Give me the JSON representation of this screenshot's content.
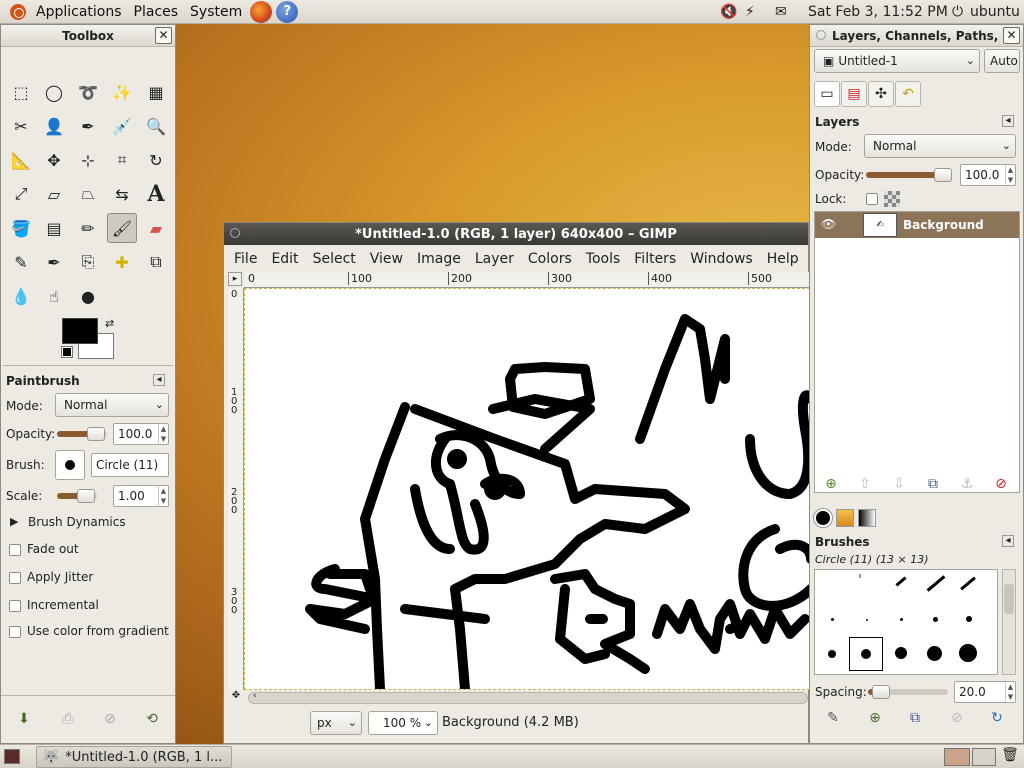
{
  "top_panel": {
    "menus": [
      "Applications",
      "Places",
      "System"
    ],
    "clock": "Sat Feb  3, 11:52 PM",
    "user": "ubuntu"
  },
  "toolbox": {
    "title": "Toolbox",
    "options_title": "Paintbrush",
    "mode_label": "Mode:",
    "mode_value": "Normal",
    "opacity_label": "Opacity:",
    "opacity_value": "100.0",
    "brush_label": "Brush:",
    "brush_value": "Circle (11)",
    "scale_label": "Scale:",
    "scale_value": "1.00",
    "dynamics_label": "Brush Dynamics",
    "fade_label": "Fade out",
    "jitter_label": "Apply Jitter",
    "incremental_label": "Incremental",
    "gradient_label": "Use color from gradient",
    "fg_color": "#000000",
    "bg_color": "#ffffff"
  },
  "image_window": {
    "title": "*Untitled-1.0 (RGB, 1 layer) 640x400 – GIMP",
    "menus": [
      "File",
      "Edit",
      "Select",
      "View",
      "Image",
      "Layer",
      "Colors",
      "Tools",
      "Filters",
      "Windows",
      "Help"
    ],
    "ruler_marks": [
      "0",
      "100",
      "200",
      "300",
      "400",
      "500"
    ],
    "vruler_marks": [
      "0",
      "1\n0\n0",
      "2\n0\n0",
      "3\n0\n0"
    ],
    "unit": "px",
    "zoom": "100 %",
    "status": "Background (4.2 MB)"
  },
  "layers_dock": {
    "title": "Layers, Channels, Paths, U",
    "image_select": "Untitled-1",
    "auto_label": "Auto",
    "layers_title": "Layers",
    "mode_label": "Mode:",
    "mode_value": "Normal",
    "opacity_label": "Opacity:",
    "opacity_value": "100.0",
    "lock_label": "Lock:",
    "layer_name": "Background",
    "brushes_title": "Brushes",
    "brush_info": "Circle (11) (13 × 13)",
    "spacing_label": "Spacing:",
    "spacing_value": "20.0"
  },
  "taskbar": {
    "task_label": "*Untitled-1.0 (RGB, 1 l..."
  },
  "colors": {
    "selected_layer": "#8c7459",
    "slider_fill": "#8a5b2e"
  }
}
